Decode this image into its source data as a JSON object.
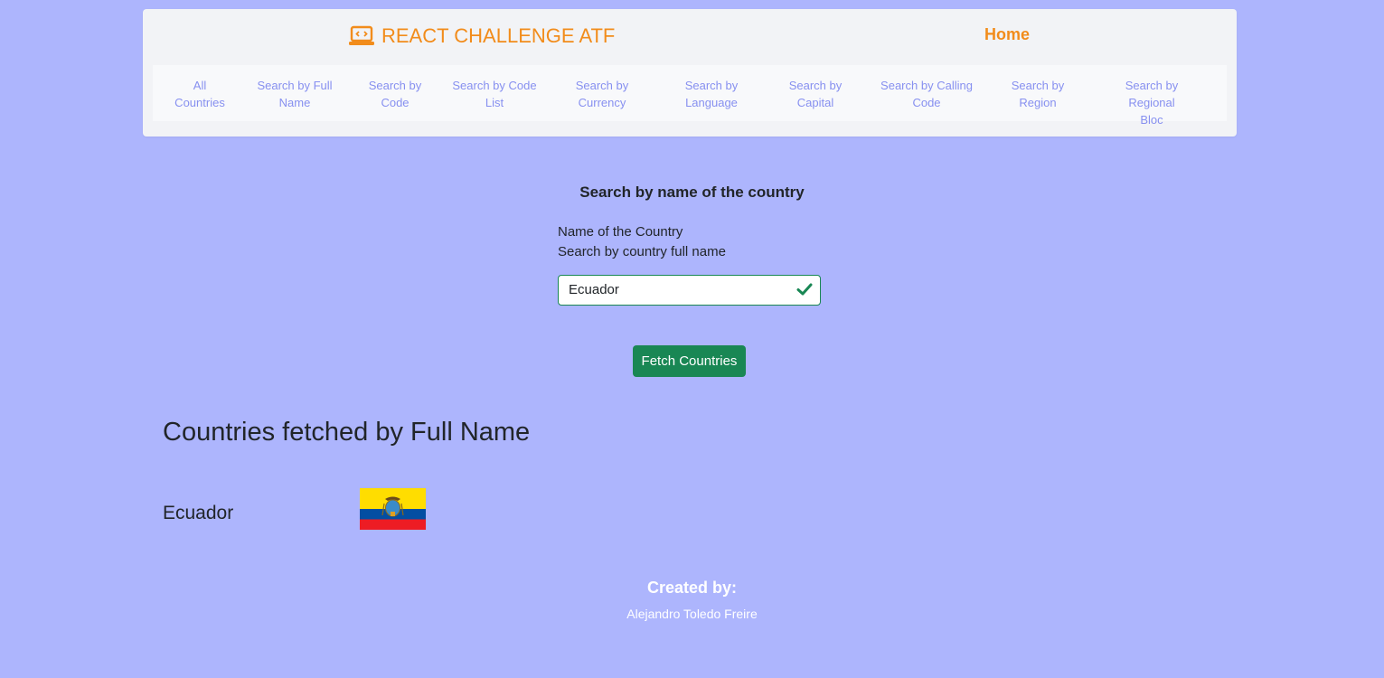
{
  "navbar": {
    "brand": "REACT CHALLENGE ATF",
    "brand_icon": "laptop-code-icon",
    "home": "Home",
    "accent_color": "#f28c1b",
    "links": [
      {
        "line1": "All",
        "line2": "Countries"
      },
      {
        "line1": "Search by Full",
        "line2": "Name"
      },
      {
        "line1": "Search by",
        "line2": "Code"
      },
      {
        "line1": "Search by Code",
        "line2": "List"
      },
      {
        "line1": "Search by",
        "line2": "Currency"
      },
      {
        "line1": "Search by",
        "line2": "Language"
      },
      {
        "line1": "Search by",
        "line2": "Capital"
      },
      {
        "line1": "Search by Calling",
        "line2": "Code"
      },
      {
        "line1": "Search by",
        "line2": "Region"
      },
      {
        "line1": "Search by Regional",
        "line2": "Bloc"
      }
    ]
  },
  "form": {
    "title": "Search by name of the country",
    "label": "Name of the Country",
    "helper": "Search by country full name",
    "input_value": "Ecuador",
    "valid_icon": "check-icon",
    "button": "Fetch Countries"
  },
  "results": {
    "heading": "Countries fetched by Full Name",
    "countries": [
      {
        "name": "Ecuador",
        "flag_icon": "ecuador-flag"
      }
    ]
  },
  "footer": {
    "created_by": "Created by:",
    "author": "Alejandro Toledo Freire"
  },
  "colors": {
    "background": "#adb5fd",
    "navbar": "#f2f3f6",
    "success": "#198754",
    "link": "#8790f0"
  }
}
